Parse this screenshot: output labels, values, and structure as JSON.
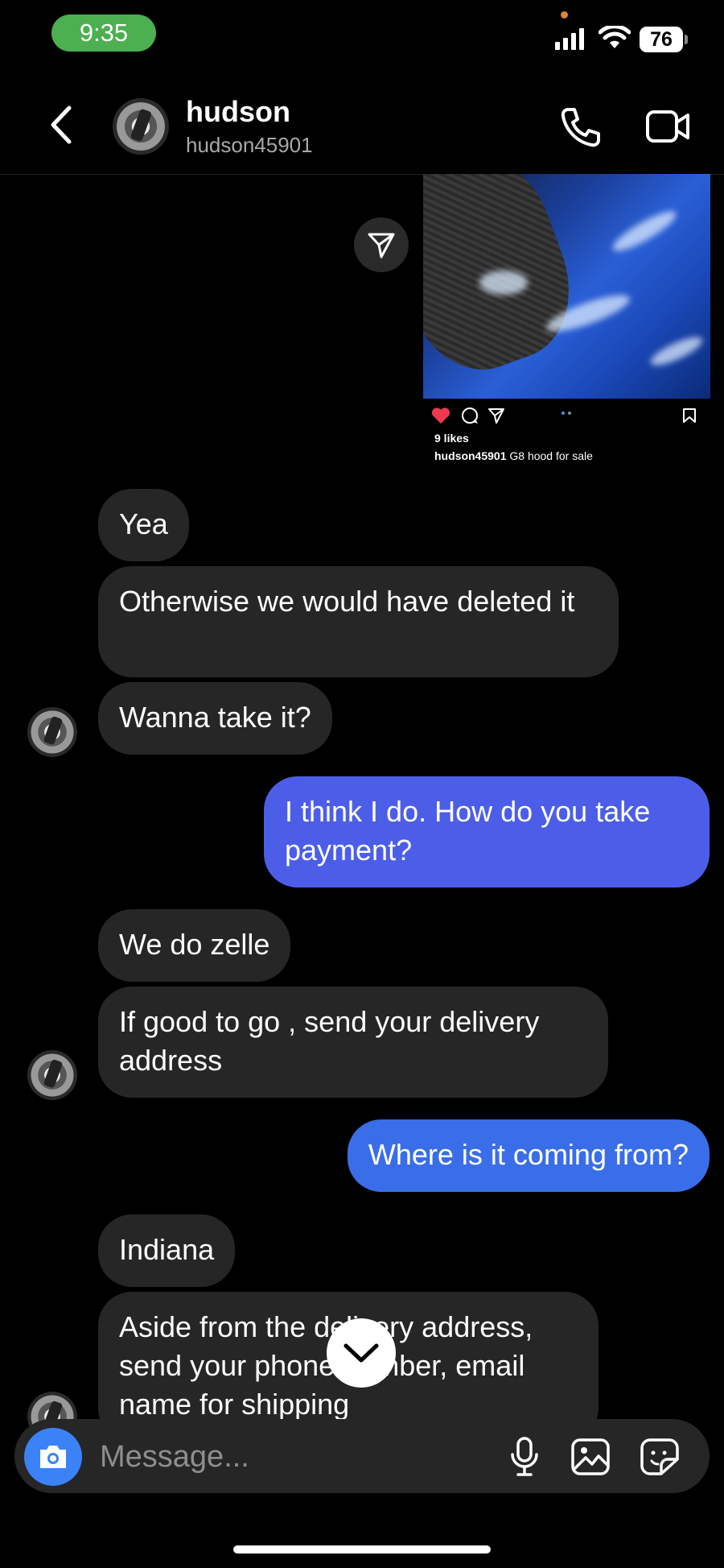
{
  "status_bar": {
    "time": "9:35",
    "battery": "76"
  },
  "header": {
    "name": "hudson",
    "handle": "hudson45901"
  },
  "post": {
    "likes": "9 likes",
    "caption_user": "hudson45901",
    "caption_text": "G8 hood for sale"
  },
  "messages": [
    {
      "side": "in",
      "text": "Yea"
    },
    {
      "side": "in",
      "text": "Otherwise we would have deleted it"
    },
    {
      "side": "in",
      "text": "Wanna take it?"
    },
    {
      "side": "out",
      "text": "I think I do. How do you take payment?"
    },
    {
      "side": "in",
      "text": "We do zelle"
    },
    {
      "side": "in",
      "text": "If good to go , send your delivery address"
    },
    {
      "side": "out",
      "text": "Where is it coming from?"
    },
    {
      "side": "in",
      "text": "Indiana"
    },
    {
      "side": "in",
      "text": "Aside from the delivery address, send your phone number, email name for shipping"
    }
  ],
  "composer": {
    "placeholder": "Message..."
  },
  "colors": {
    "outgoing_bubble": "#4c5ee8",
    "incoming_bubble": "#262626",
    "accent": "#3b82f6"
  },
  "icons": [
    "back-chevron-icon",
    "phone-icon",
    "video-icon",
    "share-icon",
    "heart-icon",
    "comment-icon",
    "send-icon",
    "bookmark-icon",
    "camera-icon",
    "microphone-icon",
    "gallery-icon",
    "sticker-icon",
    "chevron-down-icon"
  ]
}
